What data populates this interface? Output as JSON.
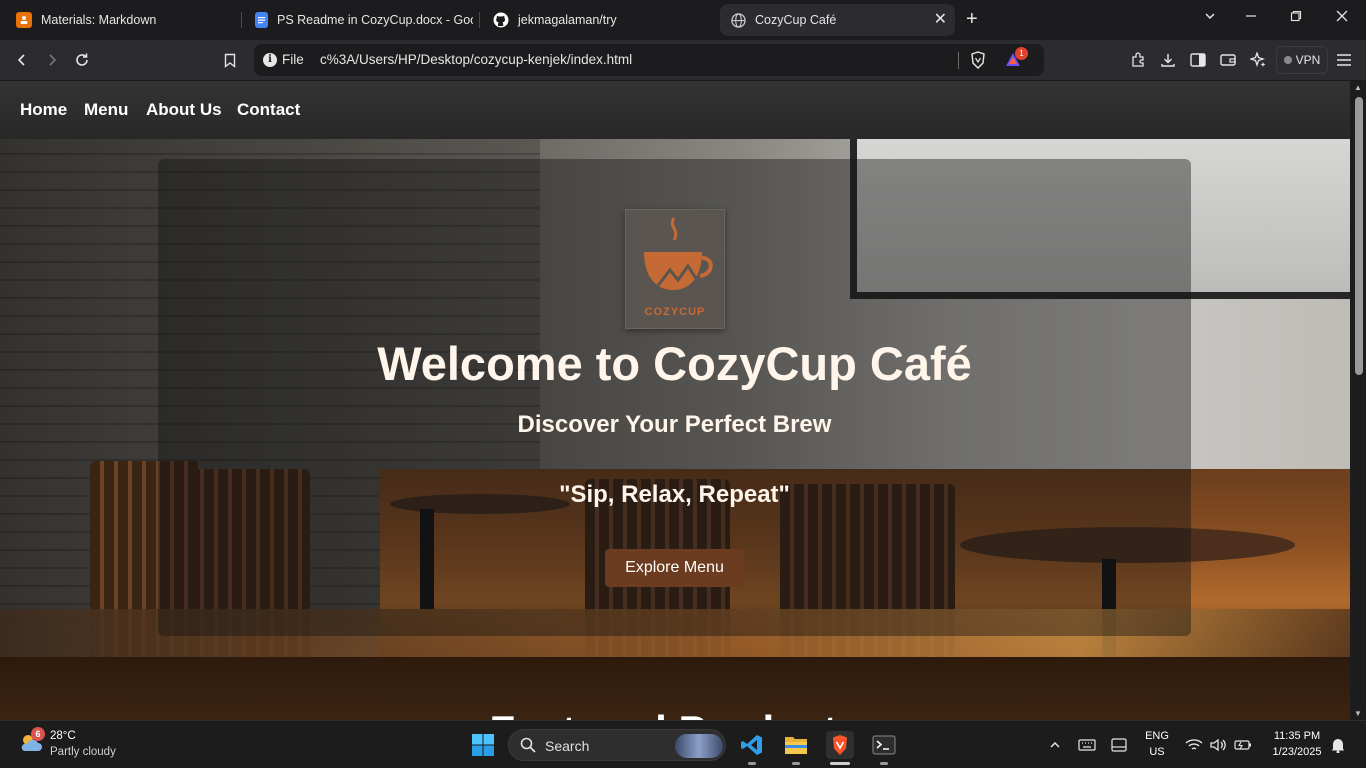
{
  "browser": {
    "tabs": [
      {
        "title": "Materials: Markdown",
        "favicon": "person-board-icon",
        "color": "#e8710a"
      },
      {
        "title": "PS Readme in CozyCup.docx - Goog",
        "favicon": "docs-icon",
        "color": "#4285f4"
      },
      {
        "title": "jekmagalaman/try",
        "favicon": "github-icon",
        "color": "#ffffff"
      },
      {
        "title": "CozyCup Café",
        "favicon": "globe-icon",
        "color": "#c8c8c8",
        "active": true
      }
    ],
    "address": {
      "scheme_label": "File",
      "url": "c%3A/Users/HP/Desktop/cozycup-kenjek/index.html"
    },
    "rewards_badge": "1",
    "vpn_label": "VPN"
  },
  "site": {
    "nav": [
      "Home",
      "Menu",
      "About Us",
      "Contact"
    ],
    "hero": {
      "logo_text": "COZYCUP",
      "title": "Welcome to CozyCup Café",
      "subtitle": "Discover Your Perfect Brew",
      "tagline": "\"Sip, Relax, Repeat\"",
      "button": "Explore Menu"
    },
    "featured_title": "Featured Products",
    "colors": {
      "button": "#6b3c1f",
      "featured_bg": "#3b2412",
      "hero_text": "#fff5ea"
    }
  },
  "taskbar": {
    "weather": {
      "temp": "28°C",
      "condition": "Partly cloudy",
      "badge": "6"
    },
    "search_label": "Search",
    "lang": {
      "line1": "ENG",
      "line2": "US"
    },
    "time": "11:35 PM",
    "date": "1/23/2025"
  }
}
